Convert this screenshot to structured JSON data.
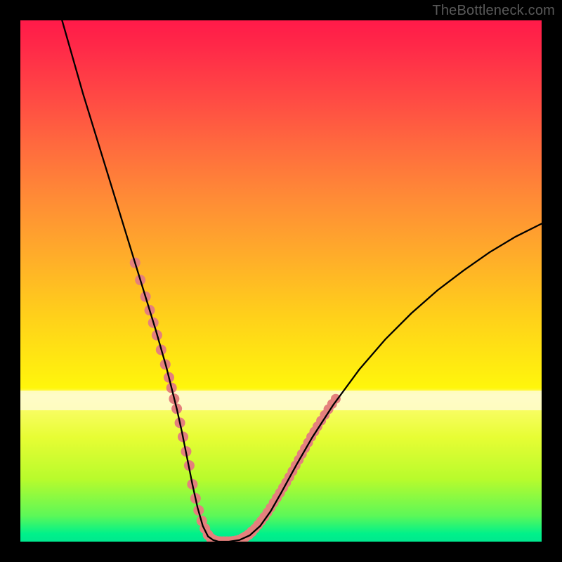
{
  "watermark": "TheBottleneck.com",
  "chart_data": {
    "type": "line",
    "title": "",
    "xlabel": "",
    "ylabel": "",
    "xlim": [
      0,
      100
    ],
    "ylim": [
      0,
      100
    ],
    "grid": false,
    "series": [
      {
        "name": "bottleneck-curve",
        "stroke": "#000000",
        "x": [
          8,
          10,
          12,
          14,
          16,
          18,
          20,
          22,
          24,
          26,
          28,
          29,
          30,
          31,
          32,
          33,
          34,
          35,
          36,
          37,
          38,
          40,
          42,
          44,
          46,
          48,
          50,
          53,
          56,
          60,
          65,
          70,
          75,
          80,
          85,
          90,
          95,
          100
        ],
        "y": [
          100,
          93,
          86,
          79.5,
          73,
          66.5,
          60,
          53.5,
          47,
          40.5,
          33.5,
          29.5,
          25.5,
          21,
          16,
          11,
          6.5,
          3,
          1,
          0.3,
          0,
          0,
          0.3,
          1.2,
          3,
          5.8,
          9.3,
          14.8,
          20,
          26.2,
          33,
          38.8,
          43.8,
          48.2,
          52,
          55.5,
          58.5,
          61
        ]
      }
    ],
    "markers": {
      "name": "highlight-points",
      "color": "#e4807d",
      "left_branch": {
        "x": [
          22.0,
          23.0,
          24.0,
          24.8,
          25.5,
          26.2,
          27.0,
          27.8,
          28.5,
          29.0,
          29.5,
          30.0,
          30.6,
          31.2,
          31.8,
          32.4,
          33.0,
          33.6,
          34.2,
          34.8,
          35.4,
          36.0,
          36.6,
          37.2,
          37.8,
          38.4,
          39.0,
          39.6,
          40.2,
          40.8,
          41.4,
          42.0,
          42.6,
          43.2,
          43.8,
          44.4
        ],
        "y": [
          53.5,
          50.2,
          47.0,
          44.4,
          42.0,
          39.6,
          36.8,
          34.0,
          31.5,
          29.5,
          27.4,
          25.5,
          22.8,
          20.1,
          17.3,
          14.6,
          11.0,
          8.3,
          6.0,
          4.0,
          2.5,
          1.3,
          0.6,
          0.25,
          0.05,
          0.0,
          0.0,
          0.0,
          0.0,
          0.05,
          0.15,
          0.3,
          0.6,
          0.95,
          1.35,
          1.9
        ]
      },
      "right_branch": {
        "x": [
          45.0,
          45.6,
          46.2,
          46.8,
          47.4,
          48.0,
          48.6,
          49.2,
          49.8,
          50.4,
          51.0,
          51.6,
          52.2,
          52.8,
          53.4,
          54.0,
          54.6,
          55.2,
          55.8,
          56.4,
          57.0,
          57.7,
          58.4,
          59.1,
          59.8,
          60.5
        ],
        "y": [
          2.5,
          3.2,
          3.95,
          4.75,
          5.6,
          6.5,
          7.45,
          8.4,
          9.35,
          10.35,
          11.35,
          12.4,
          13.5,
          14.6,
          15.7,
          16.8,
          17.9,
          19.0,
          20.1,
          21.1,
          22.1,
          23.2,
          24.3,
          25.4,
          26.4,
          27.4
        ]
      }
    }
  }
}
